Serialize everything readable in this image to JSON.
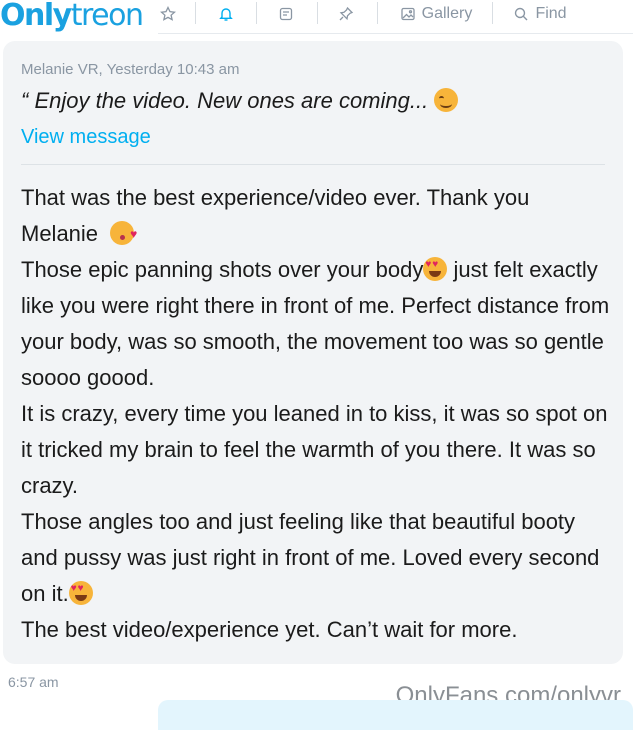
{
  "brand": {
    "logo_bold": "Only",
    "logo_rest": "treon"
  },
  "nav": {
    "items": [
      {
        "name": "nav-star",
        "icon": "star-icon",
        "label": ""
      },
      {
        "name": "nav-notifications",
        "icon": "bell-icon",
        "label": ""
      },
      {
        "name": "nav-notes",
        "icon": "note-icon",
        "label": ""
      },
      {
        "name": "nav-pinned",
        "icon": "pin-icon",
        "label": ""
      },
      {
        "name": "nav-gallery",
        "icon": "image-icon",
        "label": "Gallery"
      },
      {
        "name": "nav-find",
        "icon": "search-icon",
        "label": "Find"
      }
    ],
    "active": "nav-notifications"
  },
  "message": {
    "reply_meta": "Melanie VR, Yesterday 10:43 am",
    "reply_quote": "“ Enjoy the video. New ones are coming...",
    "view_label": "View message",
    "paragraphs": [
      {
        "text": "That was the best experience/video ever. Thank you Melanie",
        "emoji": "kiss"
      },
      {
        "text_before": "Those epic panning shots over your body",
        "emoji": "hearteyes",
        "text_after": " just felt exactly like you were right there in front of me. Perfect distance from your body, was so smooth, the movement too was so gentle soooo goood."
      },
      {
        "text": "It is crazy, every time you leaned in to kiss, it was so spot on it tricked my brain to feel the warmth of you there. It was so crazy."
      },
      {
        "text": "Those angles too and just feeling like that beautiful booty and pussy was just right in front of me. Loved every second on it.",
        "emoji": "hearteyes"
      },
      {
        "text": "The best video/experience yet. Can’t wait for more."
      }
    ],
    "time": "6:57 am"
  },
  "watermark": "OnlyFans.com/onlyvr",
  "colors": {
    "accent": "#00aff0",
    "bubble": "#f2f4f6",
    "muted": "#8a96a3"
  }
}
